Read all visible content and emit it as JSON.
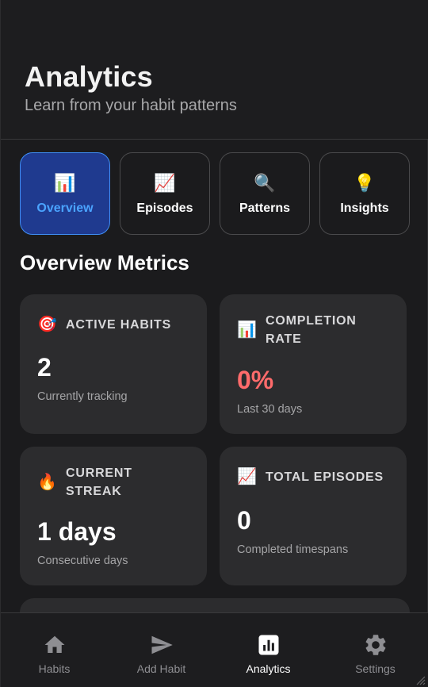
{
  "header": {
    "title": "Analytics",
    "subtitle": "Learn from your habit patterns"
  },
  "tabs": [
    {
      "label": "Overview",
      "icon": "📊",
      "icon_name": "bar-chart-icon",
      "active": true
    },
    {
      "label": "Episodes",
      "icon": "📈",
      "icon_name": "trend-up-icon",
      "active": false
    },
    {
      "label": "Patterns",
      "icon": "🔍",
      "icon_name": "magnifier-icon",
      "active": false
    },
    {
      "label": "Insights",
      "icon": "💡",
      "icon_name": "lightbulb-icon",
      "active": false
    }
  ],
  "section": {
    "title": "Overview Metrics"
  },
  "metrics": [
    {
      "title": "ACTIVE HABITS",
      "icon": "🎯",
      "icon_name": "target-icon",
      "value": "2",
      "subtitle": "Currently tracking"
    },
    {
      "title_line1": "COMPLETION",
      "title_line2": "RATE",
      "icon": "📊",
      "icon_name": "bar-chart-icon",
      "value": "0%",
      "subtitle": "Last 30 days"
    },
    {
      "title_line1": "CURRENT",
      "title_line2": "STREAK",
      "icon": "🔥",
      "icon_name": "fire-icon",
      "value": "1 days",
      "subtitle": "Consecutive days"
    },
    {
      "title": "TOTAL EPISODES",
      "icon": "📈",
      "icon_name": "trend-up-icon",
      "value": "0",
      "subtitle": "Completed timespans"
    }
  ],
  "nav": [
    {
      "label": "Habits",
      "icon_name": "home-icon",
      "active": false
    },
    {
      "label": "Add Habit",
      "icon_name": "send-icon",
      "active": false
    },
    {
      "label": "Analytics",
      "icon_name": "analytics-icon",
      "active": true
    },
    {
      "label": "Settings",
      "icon_name": "gear-icon",
      "active": false
    }
  ],
  "colors": {
    "accent": "#3f8ef5",
    "active_tab_bg": "#1f3a8f",
    "danger": "#ff6b6b",
    "card_bg": "#2c2c2e",
    "background": "#1b1b1d"
  }
}
